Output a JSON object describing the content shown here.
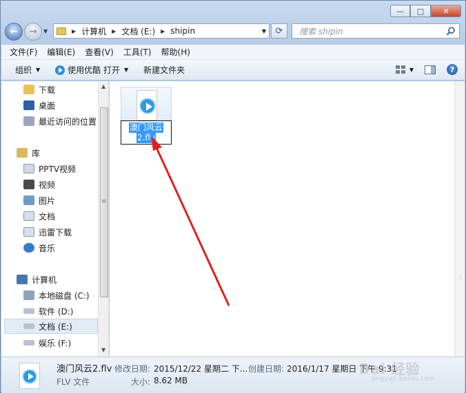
{
  "window": {
    "min_label": "—",
    "max_label": "□",
    "close_label": "✕"
  },
  "address": {
    "segments": [
      "计算机",
      "文档 (E:)",
      "shipin"
    ]
  },
  "search": {
    "placeholder": "搜索 shipin"
  },
  "menu": [
    "文件(F)",
    "编辑(E)",
    "查看(V)",
    "工具(T)",
    "帮助(H)"
  ],
  "toolbar": {
    "organize": "组织",
    "open_with": "使用优酷 打开",
    "new_folder": "新建文件夹"
  },
  "nav": {
    "items": [
      {
        "label": "下载",
        "icon": "download-folder-icon",
        "color": "#e5c25a"
      },
      {
        "label": "桌面",
        "icon": "desktop-icon",
        "color": "#2d5ea8"
      },
      {
        "label": "最近访问的位置",
        "icon": "recent-places-icon",
        "color": "#9aa7b8"
      },
      {
        "label": "库",
        "icon": "library-icon",
        "color": "#d9b860"
      },
      {
        "label": "PPTV视频",
        "icon": "pptv-icon",
        "color": "#cfd8e4"
      },
      {
        "label": "视频",
        "icon": "video-library-icon",
        "color": "#4a4a4a"
      },
      {
        "label": "图片",
        "icon": "pictures-library-icon",
        "color": "#6e9bc9"
      },
      {
        "label": "文档",
        "icon": "documents-library-icon",
        "color": "#d8dee8"
      },
      {
        "label": "迅雷下载",
        "icon": "thunder-download-icon",
        "color": "#d8dee8"
      },
      {
        "label": "音乐",
        "icon": "music-library-icon",
        "color": "#3a7bc8"
      },
      {
        "label": "计算机",
        "icon": "computer-icon",
        "color": "#4a76b0"
      },
      {
        "label": "本地磁盘 (C:)",
        "icon": "system-drive-icon",
        "color": "#8fa2b8"
      },
      {
        "label": "软件 (D:)",
        "icon": "drive-d-icon",
        "color": "#b8c2cf"
      },
      {
        "label": "文档 (E:)",
        "icon": "drive-e-icon",
        "color": "#b8c2cf"
      },
      {
        "label": "娱乐 (F:)",
        "icon": "drive-f-icon",
        "color": "#b8c2cf"
      }
    ],
    "selected_index": 13
  },
  "file": {
    "name_line1": "澳门风云",
    "name_line2": "2.flv",
    "icon": "flv-video-file-icon"
  },
  "details": {
    "name": "澳门风云2.flv",
    "type": "FLV 文件",
    "modified_label": "修改日期:",
    "modified_value": "2015/12/22 星期二 下...",
    "created_label": "创建日期:",
    "created_value": "2016/1/17 星期日 下午 9:31",
    "size_label": "大小:",
    "size_value": "8.62 MB"
  },
  "watermark": {
    "text": "Bai 经验",
    "sub": "jingyan.baidu.com"
  },
  "colors": {
    "selection": "#3399ff",
    "arrow": "#e02020",
    "accent": "#2f9ae3"
  }
}
